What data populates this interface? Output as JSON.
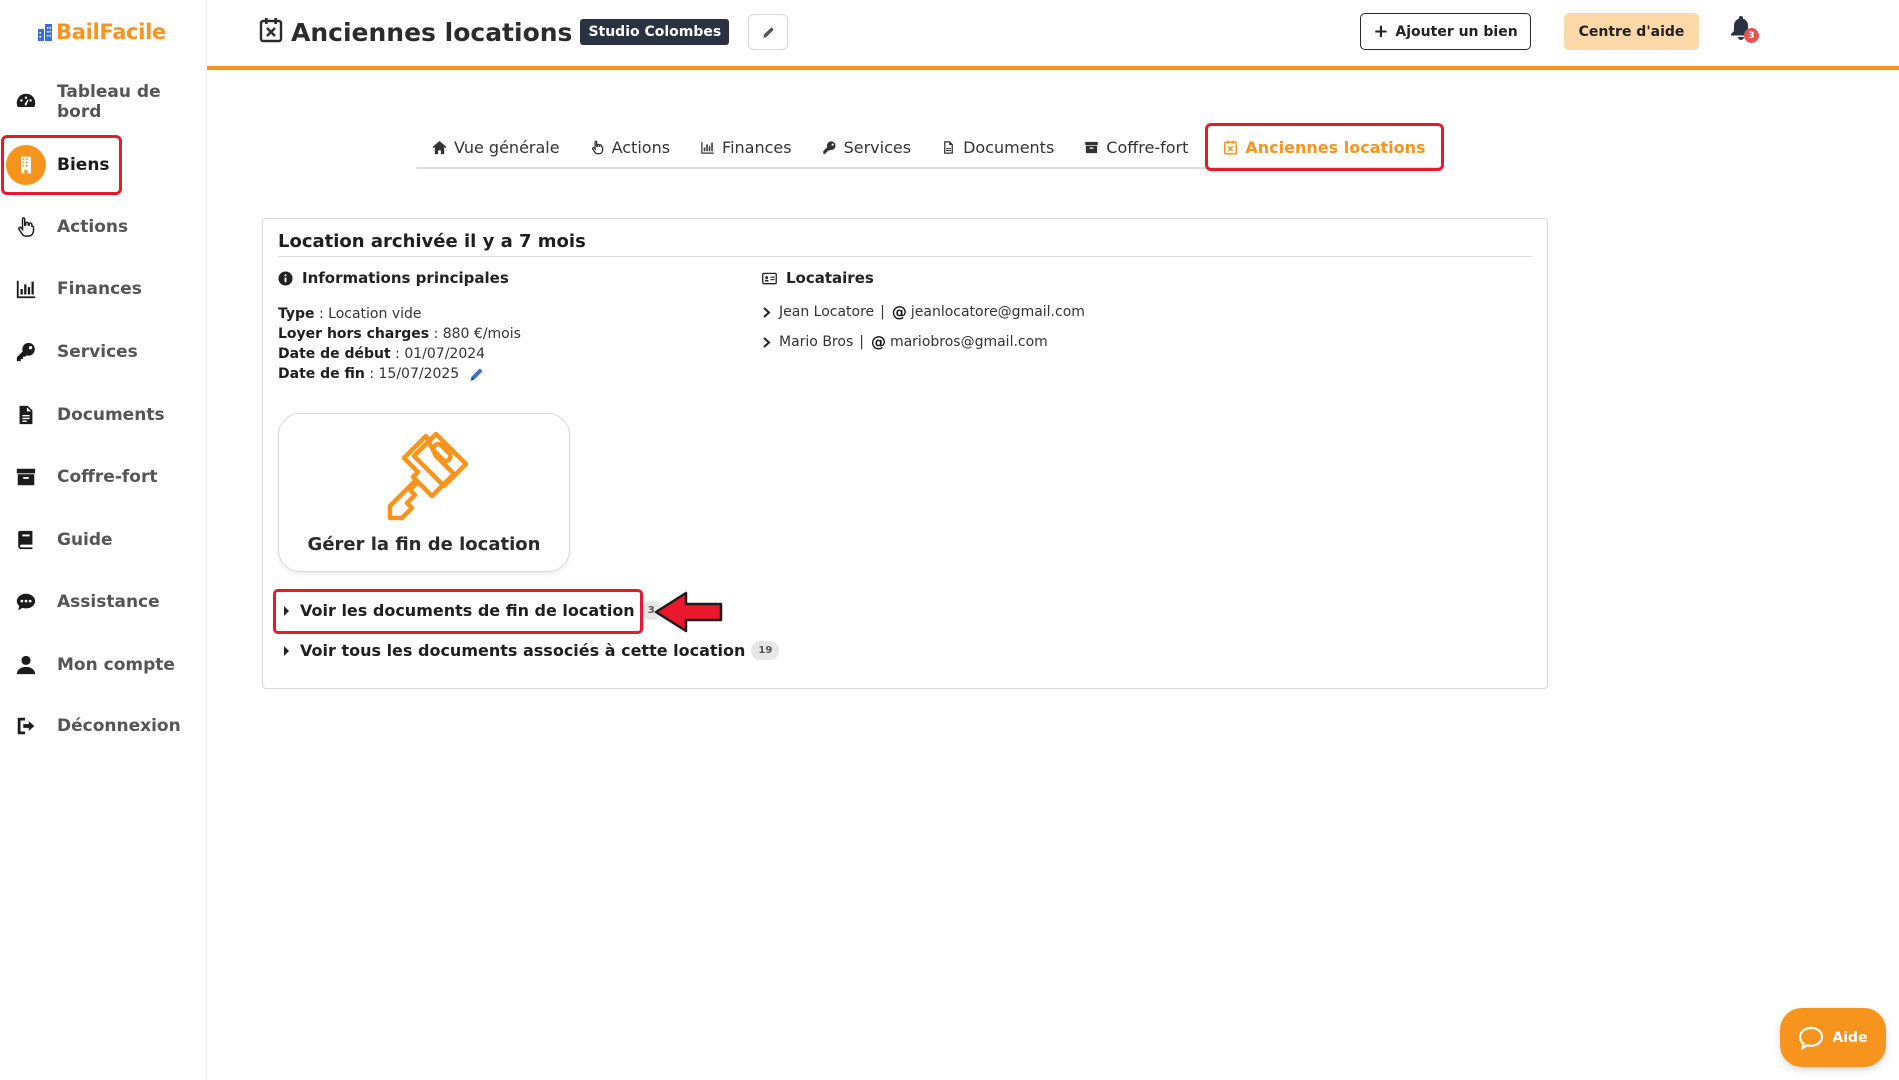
{
  "app": {
    "logo": "BailFacile"
  },
  "sidebar": {
    "items": [
      {
        "label": "Tableau de bord",
        "icon": "gauge-icon"
      },
      {
        "label": "Biens",
        "icon": "building-icon",
        "active": true
      },
      {
        "label": "Actions",
        "icon": "hand-pointer-icon"
      },
      {
        "label": "Finances",
        "icon": "bar-chart-icon"
      },
      {
        "label": "Services",
        "icon": "key-icon"
      },
      {
        "label": "Documents",
        "icon": "document-icon"
      },
      {
        "label": "Coffre-fort",
        "icon": "archive-icon"
      },
      {
        "label": "Guide",
        "icon": "book-icon"
      },
      {
        "label": "Assistance",
        "icon": "chat-icon"
      },
      {
        "label": "Mon compte",
        "icon": "user-icon"
      },
      {
        "label": "Déconnexion",
        "icon": "logout-icon"
      }
    ]
  },
  "header": {
    "title": "Anciennes locations",
    "property_badge": "Studio Colombes",
    "add_button": "Ajouter un bien",
    "help_button": "Centre d'aide",
    "notification_count": "3"
  },
  "tabs": [
    {
      "label": "Vue générale",
      "icon": "home-icon"
    },
    {
      "label": "Actions",
      "icon": "hand-pointer-icon"
    },
    {
      "label": "Finances",
      "icon": "bar-chart-icon"
    },
    {
      "label": "Services",
      "icon": "key-icon"
    },
    {
      "label": "Documents",
      "icon": "document-icon"
    },
    {
      "label": "Coffre-fort",
      "icon": "archive-icon"
    },
    {
      "label": "Anciennes locations",
      "icon": "calendar-x-icon",
      "active": true
    }
  ],
  "lease": {
    "title": "Location archivée il y a 7 mois",
    "main_info_heading": "Informations principales",
    "type_label": "Type",
    "type_value": "Location vide",
    "rent_label": "Loyer hors charges",
    "rent_value": "880 €/mois",
    "start_label": "Date de début",
    "start_value": "01/07/2024",
    "end_label": "Date de fin",
    "end_value": "15/07/2025",
    "tenants_heading": "Locataires",
    "tenants": [
      {
        "name": "Jean Locatore",
        "email": "jeanlocatore@gmail.com"
      },
      {
        "name": "Mario Bros",
        "email": "mariobros@gmail.com"
      }
    ],
    "manage_label": "Gérer la fin de location",
    "end_docs_link": "Voir les documents de fin de location",
    "end_docs_count": "3",
    "all_docs_link": "Voir tous les documents associés à cette location",
    "all_docs_count": "19"
  },
  "fab": {
    "label": "Aide"
  },
  "colors": {
    "accent": "#f7941d",
    "highlight": "#e8192c",
    "badge_dark": "#2a3242"
  }
}
